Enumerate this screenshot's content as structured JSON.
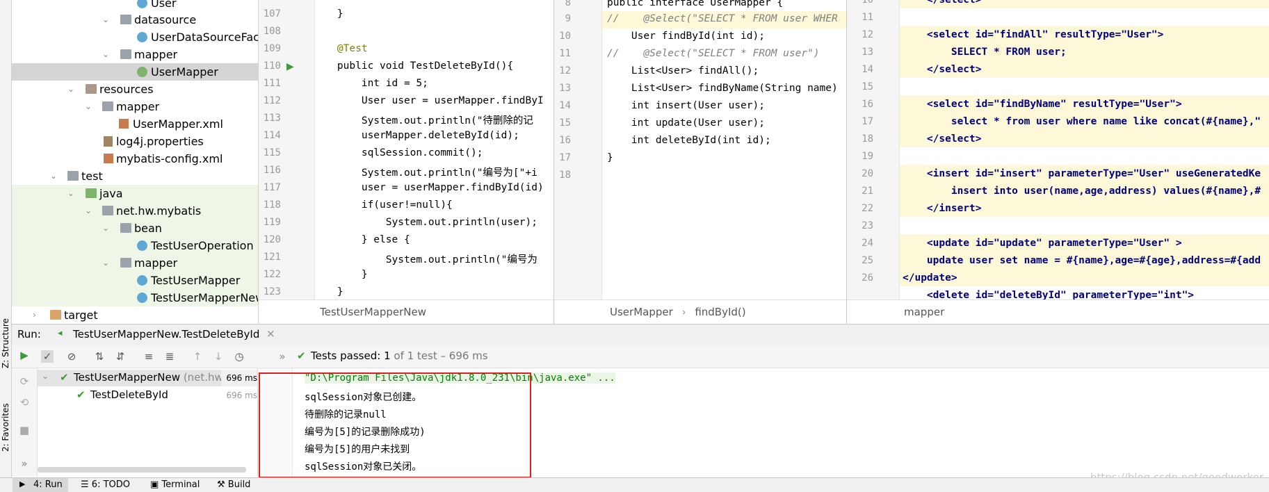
{
  "side_tabs": {
    "structure": "Z: Structure",
    "favorites": "2: Favorites"
  },
  "project_tree": {
    "items": [
      {
        "label": "User",
        "type": "class"
      },
      {
        "label": "datasource",
        "type": "package"
      },
      {
        "label": "UserDataSourceFacto",
        "type": "class"
      },
      {
        "label": "mapper",
        "type": "package"
      },
      {
        "label": "UserMapper",
        "type": "interface"
      },
      {
        "label": "resources",
        "type": "resources-folder"
      },
      {
        "label": "mapper",
        "type": "folder"
      },
      {
        "label": "UserMapper.xml",
        "type": "xml"
      },
      {
        "label": "log4j.properties",
        "type": "properties"
      },
      {
        "label": "mybatis-config.xml",
        "type": "xml"
      },
      {
        "label": "test",
        "type": "folder"
      },
      {
        "label": "java",
        "type": "test-source-folder"
      },
      {
        "label": "net.hw.mybatis",
        "type": "package"
      },
      {
        "label": "bean",
        "type": "package"
      },
      {
        "label": "TestUserOperation",
        "type": "test-class"
      },
      {
        "label": "mapper",
        "type": "package"
      },
      {
        "label": "TestUserMapper",
        "type": "test-class"
      },
      {
        "label": "TestUserMapperNew",
        "type": "test-class"
      },
      {
        "label": "target",
        "type": "excluded-folder"
      }
    ]
  },
  "editor1": {
    "breadcrumb": "TestUserMapperNew",
    "line_numbers": [
      "107",
      "108",
      "109",
      "110",
      "111",
      "112",
      "113",
      "114",
      "115",
      "116",
      "117",
      "118",
      "119",
      "120",
      "121",
      "122",
      "123"
    ],
    "lines": [
      "    }",
      "",
      "    @Test",
      "    public void TestDeleteById(){",
      "        int id = 5;",
      "        User user = userMapper.findByI",
      "        System.out.println(\"待删除的记",
      "        userMapper.deleteById(id);",
      "        sqlSession.commit();",
      "        System.out.println(\"编号为[\"+i",
      "        user = userMapper.findById(id)",
      "        if(user!=null){",
      "            System.out.println(user);",
      "        } else {",
      "            System.out.println(\"编号为",
      "        }",
      "    }"
    ]
  },
  "editor2": {
    "breadcrumb_file": "UserMapper",
    "breadcrumb_method": "findById()",
    "line_numbers": [
      "8",
      "9",
      "10",
      "11",
      "12",
      "13",
      "14",
      "15",
      "16",
      "17",
      "18"
    ],
    "lines": [
      "public interface UserMapper {",
      "//    @Select(\"SELECT * FROM user WHER",
      "    User findById(int id);",
      "//    @Select(\"SELECT * FROM user\")",
      "    List<User> findAll();",
      "    List<User> findByName(String name)",
      "    int insert(User user);",
      "    int update(User user);",
      "    int deleteById(int id);",
      "}",
      ""
    ]
  },
  "editor3": {
    "breadcrumb": "mapper",
    "line_numbers": [
      "10",
      "11",
      "12",
      "13",
      "14",
      "15",
      "16",
      "17",
      "18",
      "19",
      "20",
      "21",
      "22",
      "23",
      "24",
      "25",
      "26"
    ],
    "lines": [
      "    </select>",
      "",
      "    <select id=\"findAll\" resultType=\"User\">",
      "        SELECT * FROM user;",
      "    </select>",
      "",
      "    <select id=\"findByName\" resultType=\"User\">",
      "        select * from user where name like concat(#{name},\"",
      "    </select>",
      "",
      "    <insert id=\"insert\" parameterType=\"User\" useGeneratedKe",
      "        insert into user(name,age,address) values(#{name},#",
      "    </insert>",
      "",
      "    <update id=\"update\" parameterType=\"User\" >",
      "    update user set name = #{name},age=#{age},address=#{add",
      "</update>",
      "    <delete id=\"deleteById\" parameterType=\"int\">"
    ]
  },
  "run_panel": {
    "run_label": "Run:",
    "tab_title": "TestUserMapperNew.TestDeleteById",
    "status_prefix": "Tests passed:",
    "passed_count": "1",
    "status_suffix": "of 1 test – 696 ms",
    "test_tree": [
      {
        "label": "TestUserMapperNew",
        "detail": "(net.hw.myba",
        "time": "696 ms"
      },
      {
        "label": "TestDeleteById",
        "detail": "",
        "time": "696 ms"
      }
    ],
    "console": [
      "\"D:\\Program Files\\Java\\jdk1.8.0_231\\bin\\java.exe\" ...",
      "sqlSession对象已创建。",
      "待删除的记录null",
      "编号为[5]的记录删除成功)",
      "编号为[5]的用户未找到",
      "sqlSession对象已关闭。"
    ]
  },
  "bottom_tabs": [
    "4: Run",
    "6: TODO",
    "Terminal",
    "Build"
  ],
  "watermark": "https://blog.csdn.net/goodworker"
}
